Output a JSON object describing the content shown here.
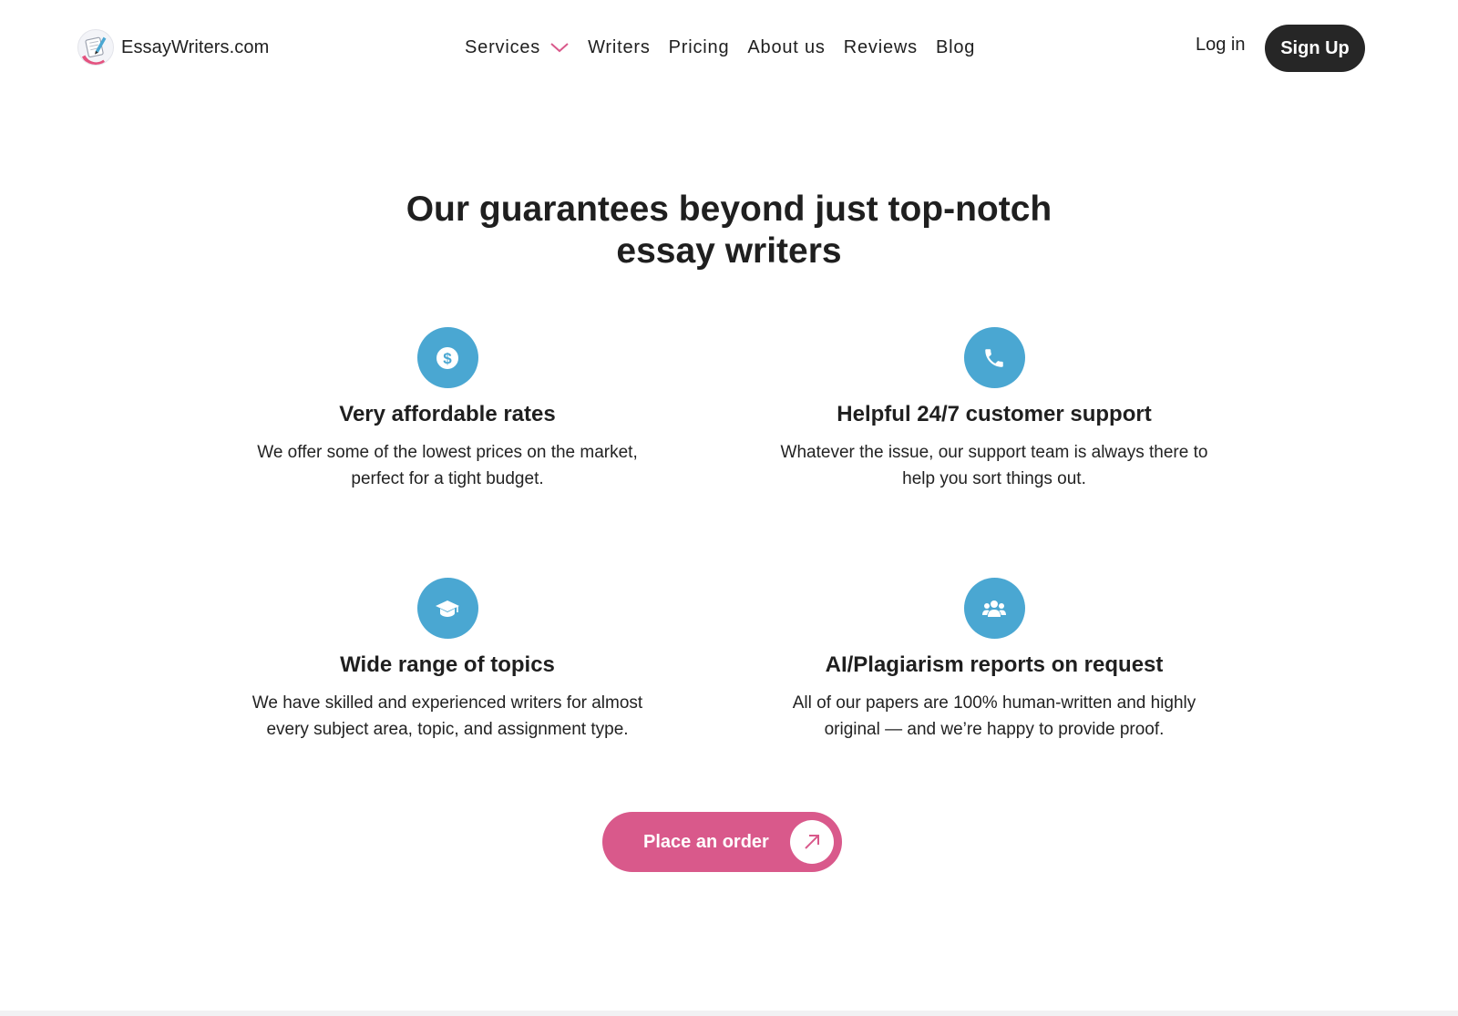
{
  "header": {
    "brand": "EssayWriters.com",
    "nav": [
      {
        "label": "Services",
        "has_dropdown": true
      },
      {
        "label": "Writers"
      },
      {
        "label": "Pricing"
      },
      {
        "label": "About us"
      },
      {
        "label": "Reviews"
      },
      {
        "label": "Blog"
      }
    ],
    "login_label": "Log in",
    "signup_label": "Sign Up"
  },
  "main": {
    "heading_line1": "Our guarantees beyond just top-notch",
    "heading_line2": "essay writers",
    "features": [
      {
        "icon": "dollar-icon",
        "title": "Very affordable rates",
        "text_line1": "We offer some of the lowest prices on the market,",
        "text_line2": "perfect for a tight budget."
      },
      {
        "icon": "phone-icon",
        "title": "Helpful 24/7 customer support",
        "text_line1": "Whatever the issue, our support team is always there to",
        "text_line2": "help you sort things out."
      },
      {
        "icon": "graduation-cap-icon",
        "title": "Wide range of topics",
        "text_line1": "We have skilled and experienced writers for almost",
        "text_line2": "every subject area, topic, and assignment type."
      },
      {
        "icon": "users-group-icon",
        "title": "AI/Plagiarism reports on request",
        "text_line1": "All of our papers are 100% human-written and highly",
        "text_line2": "original — and we’re happy to provide proof."
      }
    ],
    "cta_label": "Place an order"
  },
  "colors": {
    "accent_blue": "#4aa7d2",
    "cta_pink": "#d9598b",
    "signup_dark": "#262626",
    "text": "#1f1f1f"
  }
}
